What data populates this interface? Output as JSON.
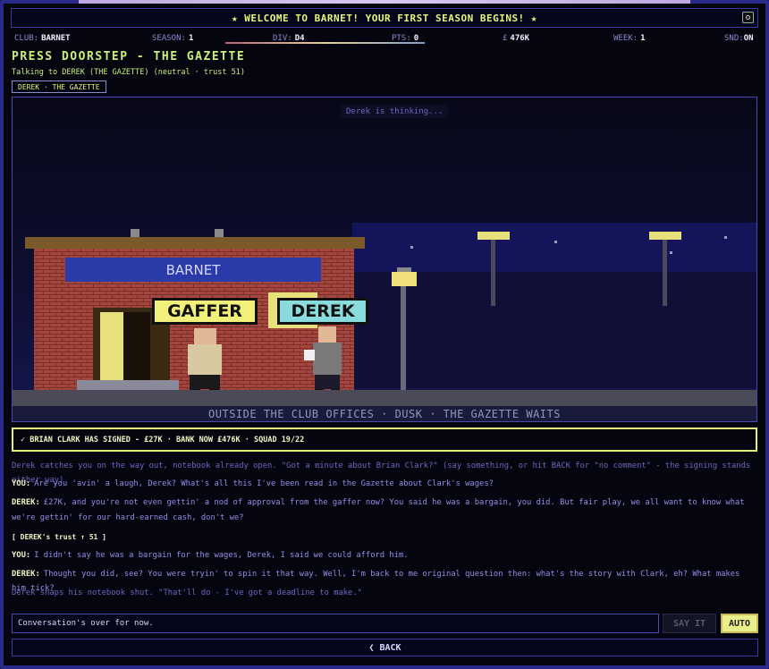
{
  "banner": {
    "text": "★ WELCOME TO BARNET! YOUR FIRST SEASON BEGINS! ★",
    "settings_icon": "gear-icon"
  },
  "status": {
    "club_label": "CLUB:",
    "club": "BARNET",
    "season_label": "SEASON:",
    "season": "1",
    "div_label": "DIV:",
    "div": "D4",
    "pts_label": "PTS:",
    "pts": "0",
    "money_label": "£",
    "money": "476K",
    "week_label": "WEEK:",
    "week": "1",
    "snd_label": "SND:",
    "snd": "ON"
  },
  "page": {
    "title": "PRESS DOORSTEP - THE GAZETTE",
    "subtitle": "Talking to DEREK (THE GAZETTE) (neutral · trust 51)",
    "tag": "DEREK · THE GAZETTE"
  },
  "scene": {
    "thinking": "Derek is thinking...",
    "sign": "BARNET",
    "gaffer_label": "GAFFER",
    "derek_label": "DEREK",
    "caption": "OUTSIDE THE CLUB OFFICES · DUSK · THE GAZETTE WAITS"
  },
  "notice": "✓ BRIAN CLARK HAS SIGNED - £27K · BANK NOW £476K · SQUAD 19/22",
  "dialogue": [
    {
      "type": "narr",
      "who": "",
      "text": "Derek catches you on the way out, notebook already open. \"Got a minute about Brian Clark?\" (say something, or hit BACK for \"no comment\" - the signing stands either way)"
    },
    {
      "type": "you",
      "who": "YOU:",
      "text": "Are you 'avin' a laugh, Derek? What's all this I've been read in the Gazette about Clark's wages?"
    },
    {
      "type": "derek",
      "who": "DEREK:",
      "text": "£27K, and you're not even gettin' a nod of approval from the gaffer now? You said he was a bargain, you did. But fair play, we all want to know what we're gettin' for our hard-earned cash, don't we?"
    },
    {
      "type": "trust",
      "who": "",
      "text": "[ DEREK's trust ↑ 51 ]"
    },
    {
      "type": "you",
      "who": "YOU:",
      "text": "I didn't say he was a bargain for the wages, Derek, I said we could afford him."
    },
    {
      "type": "derek",
      "who": "DEREK:",
      "text": "Thought you did, see? You were tryin' to spin it that way. Well, I'm back to me original question then: what's the story with Clark, eh? What makes him tick?"
    },
    {
      "type": "narr",
      "who": "",
      "text": "Derek snaps his notebook shut. \"That'll do - I've got a deadline to make.\""
    }
  ],
  "input": {
    "value": "Conversation's over for now."
  },
  "buttons": {
    "say_it": "SAY IT",
    "auto": "AUTO",
    "back": "❮ BACK"
  },
  "colors": {
    "accent": "#e6f57a",
    "frame": "#2a2a8a",
    "brick": "#a5463e"
  }
}
